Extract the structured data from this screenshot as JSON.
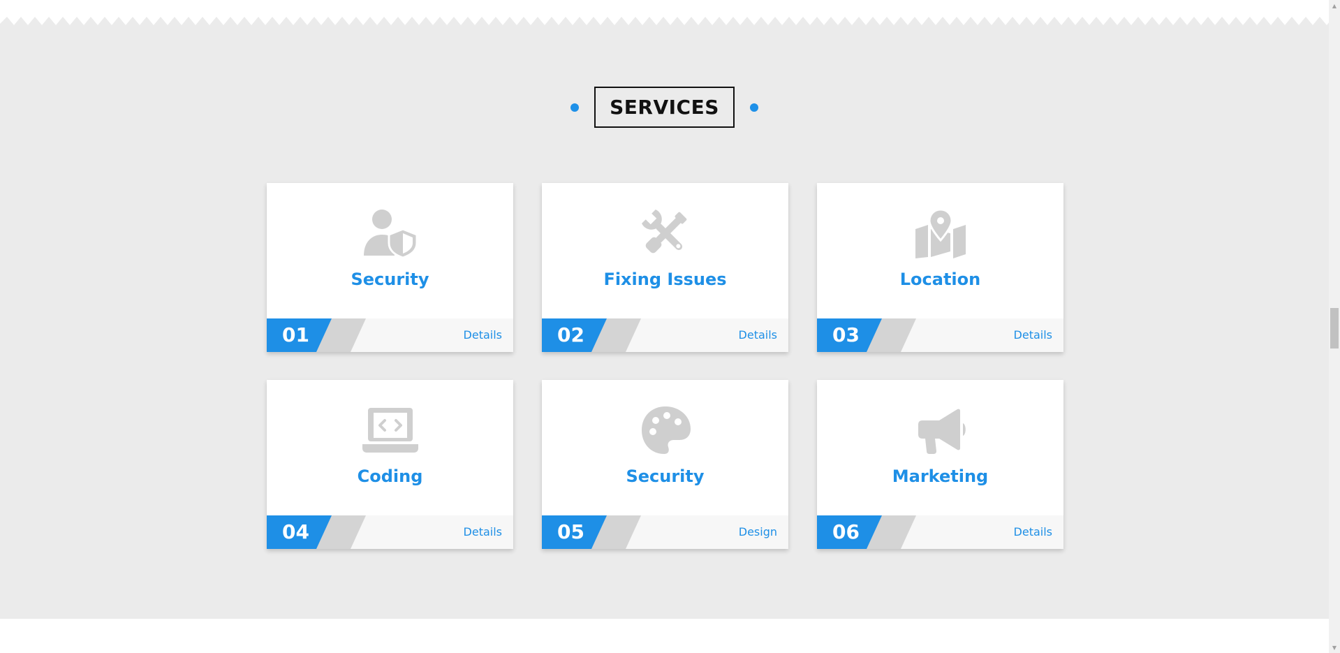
{
  "section": {
    "title": "SERVICES"
  },
  "colors": {
    "accent": "#1e8fe6",
    "icon_gray": "#cfcfcf",
    "stripe_gray": "#d4d4d4",
    "background": "#ebebeb"
  },
  "cards": [
    {
      "number": "01",
      "title": "Security",
      "link_label": "Details",
      "icon": "user-shield-icon"
    },
    {
      "number": "02",
      "title": "Fixing Issues",
      "link_label": "Details",
      "icon": "tools-icon"
    },
    {
      "number": "03",
      "title": "Location",
      "link_label": "Details",
      "icon": "map-location-icon"
    },
    {
      "number": "04",
      "title": "Coding",
      "link_label": "Details",
      "icon": "laptop-code-icon"
    },
    {
      "number": "05",
      "title": "Security",
      "link_label": "Design",
      "icon": "palette-icon"
    },
    {
      "number": "06",
      "title": "Marketing",
      "link_label": "Details",
      "icon": "megaphone-icon"
    }
  ]
}
